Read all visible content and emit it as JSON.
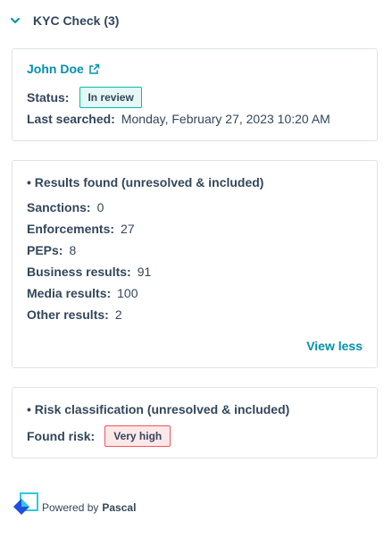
{
  "header": {
    "title": "KYC Check (3)",
    "chevron_icon": "chevron-down-icon"
  },
  "profile": {
    "name": "John Doe",
    "external_link_icon": "external-link-icon",
    "status_label": "Status:",
    "status_value": "In review",
    "last_searched_label": "Last searched:",
    "last_searched_value": "Monday, February 27, 2023 10:20 AM"
  },
  "results": {
    "title": "• Results found (unresolved & included)",
    "items": [
      {
        "label": "Sanctions:",
        "value": "0"
      },
      {
        "label": "Enforcements:",
        "value": "27"
      },
      {
        "label": "PEPs:",
        "value": "8"
      },
      {
        "label": "Business results:",
        "value": "91"
      },
      {
        "label": "Media results:",
        "value": "100"
      },
      {
        "label": "Other results:",
        "value": "2"
      }
    ],
    "view_less": "View less"
  },
  "risk": {
    "title": "• Risk classification (unresolved & included)",
    "found_risk_label": "Found risk:",
    "found_risk_value": "Very high"
  },
  "footer": {
    "powered_by": "Powered by",
    "brand": "Pascal",
    "logo_icon": "pascal-logo-icon"
  },
  "colors": {
    "accent": "#0091ae",
    "text": "#33475b",
    "review_border": "#00bda5",
    "risk_border": "#f2545b",
    "logo_blue": "#1f4fe0",
    "logo_cyan": "#31c8e0"
  }
}
